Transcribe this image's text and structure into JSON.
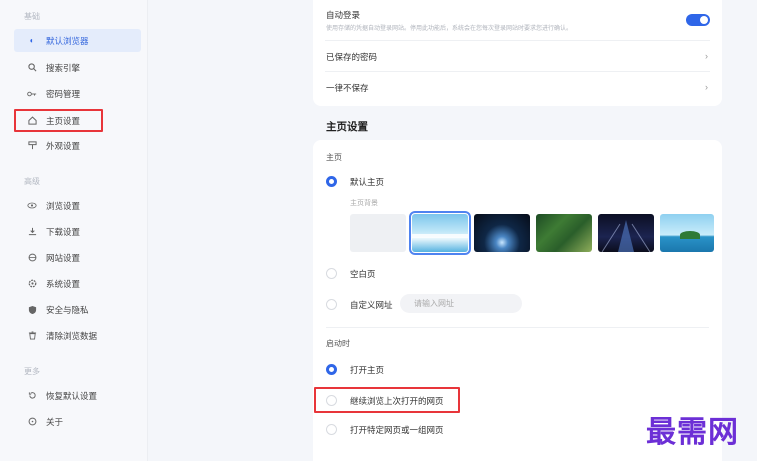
{
  "sidebar": {
    "group_basic": "基础",
    "group_advanced": "高级",
    "group_more": "更多",
    "items": [
      {
        "label": "默认浏览器",
        "icon": "default-browser-icon"
      },
      {
        "label": "搜索引擎",
        "icon": "search-icon"
      },
      {
        "label": "密码管理",
        "icon": "key-icon"
      },
      {
        "label": "主页设置",
        "icon": "home-icon"
      },
      {
        "label": "外观设置",
        "icon": "appearance-icon"
      },
      {
        "label": "浏览设置",
        "icon": "eye-icon"
      },
      {
        "label": "下载设置",
        "icon": "download-icon"
      },
      {
        "label": "网站设置",
        "icon": "globe-icon"
      },
      {
        "label": "系统设置",
        "icon": "gear-icon"
      },
      {
        "label": "安全与隐私",
        "icon": "shield-icon"
      },
      {
        "label": "清除浏览数据",
        "icon": "trash-icon"
      },
      {
        "label": "恢复默认设置",
        "icon": "reset-icon"
      },
      {
        "label": "关于",
        "icon": "info-icon"
      }
    ]
  },
  "password_card": {
    "auto_login_title": "自动登录",
    "auto_login_desc": "使用存储的凭据自动登录网站。停用此功能后，系统会在您每次登录网站时要求您进行确认。",
    "auto_login_enabled": true,
    "saved_passwords": "已保存的密码",
    "never_save": "一律不保存"
  },
  "homepage": {
    "section_title": "主页设置",
    "home_label": "主页",
    "default_home": "默认主页",
    "home_background": "主页背景",
    "blank_page": "空白页",
    "custom_url": "自定义网址",
    "url_placeholder": "请输入网址",
    "startup_label": "启动时",
    "open_home": "打开主页",
    "continue_last": "继续浏览上次打开的网页",
    "open_specific": "打开特定网页或一组网页"
  },
  "watermark": "最需网",
  "colors": {
    "accent": "#2f66e8",
    "highlight_box": "#e8353a",
    "watermark": "#6c2fd6"
  }
}
